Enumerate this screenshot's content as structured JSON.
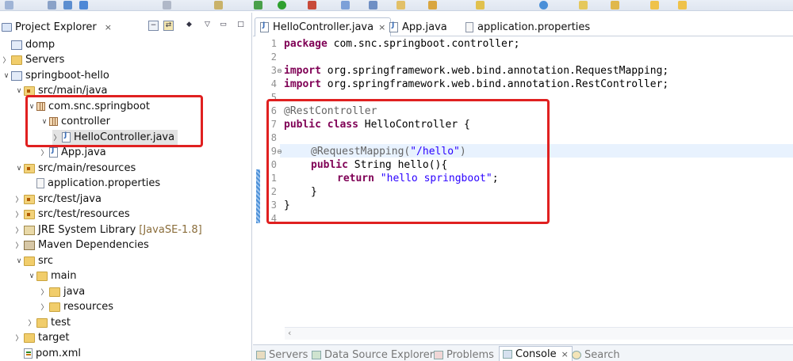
{
  "colors": {
    "accent_highlight": "#e02020",
    "keyword": "#7f0055",
    "string": "#2a00ff",
    "annotation": "#646464"
  },
  "explorer": {
    "title": "Project Explorer",
    "close_glyph": "×",
    "items": [
      {
        "label": "domp",
        "icon": "project-icon"
      },
      {
        "label": "Servers",
        "icon": "folder-icon"
      },
      {
        "label": "springboot-hello",
        "icon": "project-icon"
      },
      {
        "label": "src/main/java",
        "icon": "source-folder-icon"
      },
      {
        "label": "com.snc.springboot",
        "icon": "package-icon"
      },
      {
        "label": "controller",
        "icon": "package-icon"
      },
      {
        "label": "HelloController.java",
        "icon": "java-file-icon"
      },
      {
        "label": "App.java",
        "icon": "java-file-icon"
      },
      {
        "label": "src/main/resources",
        "icon": "source-folder-icon"
      },
      {
        "label": "application.properties",
        "icon": "properties-file-icon"
      },
      {
        "label": "src/test/java",
        "icon": "source-folder-icon"
      },
      {
        "label": "src/test/resources",
        "icon": "source-folder-icon"
      },
      {
        "label": "JRE System Library",
        "suffix": "[JavaSE-1.8]",
        "icon": "library-icon"
      },
      {
        "label": "Maven Dependencies",
        "icon": "maven-icon"
      },
      {
        "label": "src",
        "icon": "folder-icon"
      },
      {
        "label": "main",
        "icon": "folder-icon"
      },
      {
        "label": "java",
        "icon": "folder-icon"
      },
      {
        "label": "resources",
        "icon": "folder-icon"
      },
      {
        "label": "test",
        "icon": "folder-icon"
      },
      {
        "label": "target",
        "icon": "folder-icon"
      },
      {
        "label": "pom.xml",
        "icon": "xml-file-icon"
      }
    ]
  },
  "editor": {
    "tabs": [
      {
        "label": "HelloController.java",
        "close": "×",
        "active": true
      },
      {
        "label": "App.java"
      },
      {
        "label": "application.properties"
      }
    ],
    "line_numbers": [
      "1",
      "2",
      "3",
      "4",
      "5",
      "6",
      "7",
      "8",
      "9",
      "0",
      "1",
      "2",
      "3",
      "4"
    ],
    "code": {
      "l1_kw": "package",
      "l1_rest": " com.snc.springboot.controller;",
      "l3_kw": "import",
      "l3_rest": " org.springframework.web.bind.annotation.RequestMapping;",
      "l4_kw": "import",
      "l4_rest": " org.springframework.web.bind.annotation.RestController;",
      "l6_ann": "@RestController",
      "l7_kw": "public class",
      "l7_rest": " HelloController {",
      "l9_ann": "@RequestMapping(",
      "l9_str": "\"/hello\"",
      "l9_end": ")",
      "l10_kw": "public",
      "l10_rest": " String hello(){",
      "l11_kw": "return",
      "l11_str": "\"hello springboot\"",
      "l11_end": ";",
      "l12": "}",
      "l13": "}"
    }
  },
  "bottom_tabs": [
    {
      "label": "Servers"
    },
    {
      "label": "Data Source Explorer"
    },
    {
      "label": "Problems"
    },
    {
      "label": "Console",
      "close": "×",
      "active": true
    },
    {
      "label": "Search"
    }
  ]
}
